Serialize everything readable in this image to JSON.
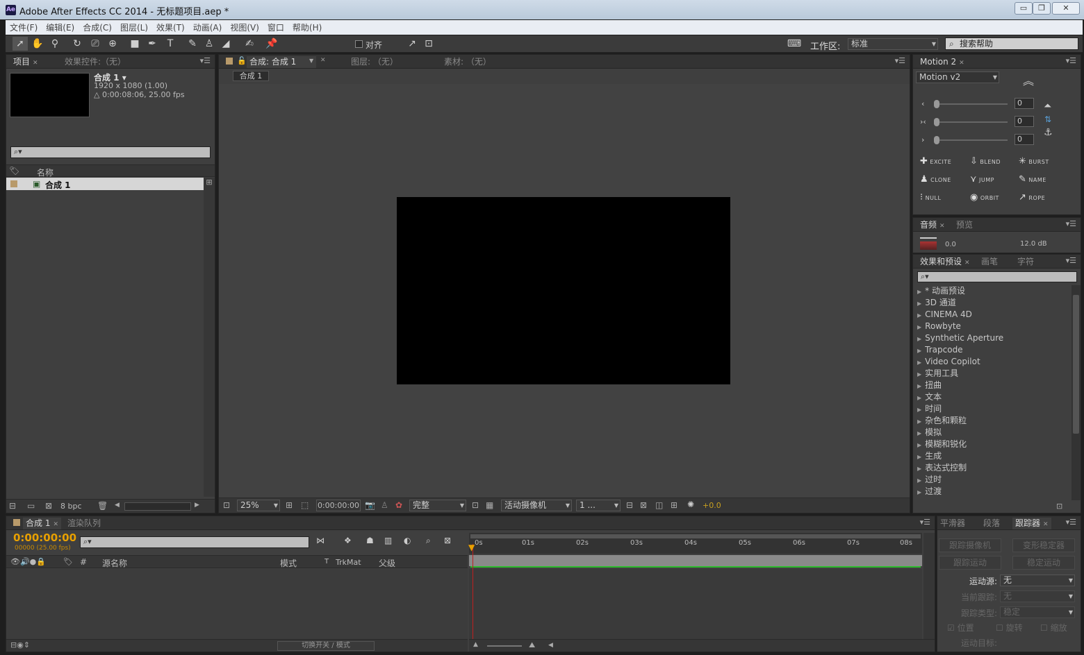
{
  "app": {
    "title": "Adobe After Effects CC 2014 - 无标题项目.aep *",
    "logo": "Ae"
  },
  "window_controls": {
    "minimize": "▭",
    "restore": "❐",
    "close": "✕"
  },
  "menu": [
    "文件(F)",
    "编辑(E)",
    "合成(C)",
    "图层(L)",
    "效果(T)",
    "动画(A)",
    "视图(V)",
    "窗口",
    "帮助(H)"
  ],
  "toolbar": {
    "snap_label": "对齐",
    "workspace_label": "工作区:",
    "workspace_value": "标准",
    "search_help_placeholder": "搜索帮助"
  },
  "project_panel": {
    "tab_project": "项目",
    "tab_effects_controls": "效果控件:（无）",
    "comp_name": "合成 1 ▾",
    "comp_res": "1920 x 1080 (1.00)",
    "comp_duration": "△ 0:00:08:06, 25.00 fps",
    "search_icon": "⌕▾",
    "col_name": "名称",
    "item_name": "合成 1",
    "bpc": "8 bpc"
  },
  "composition_panel": {
    "tab_comp": "合成: 合成 1",
    "tab_layer": "图层: （无）",
    "tab_footage": "素材: （无）",
    "subtab": "合成 1",
    "zoom": "25%",
    "timecode": "0:00:00:00",
    "resolution": "完整",
    "camera": "活动摄像机",
    "views": "1 ...",
    "exposure": "+0.0"
  },
  "motion_panel": {
    "tab": "Motion 2",
    "preset": "Motion v2",
    "slider_values": [
      "0",
      "0",
      "0"
    ],
    "buttons": [
      "EXCITE",
      "BLEND",
      "BURST",
      "CLONE",
      "JUMP",
      "NAME",
      "NULL",
      "ORBIT",
      "ROPE"
    ],
    "button_icons": [
      "✚",
      "⇩",
      "✳",
      "♟",
      "⋎",
      "✎",
      "⁝",
      "◉",
      "↗"
    ]
  },
  "audio_panel": {
    "tab_audio": "音频",
    "tab_preview": "预览",
    "level_left": "0.0",
    "level_right": "12.0 dB"
  },
  "effects_panel": {
    "tab_effects": "效果和预设",
    "tab_brush": "画笔",
    "tab_char": "字符",
    "items": [
      "* 动画预设",
      "3D 通道",
      "CINEMA 4D",
      "Rowbyte",
      "Synthetic Aperture",
      "Trapcode",
      "Video Copilot",
      "实用工具",
      "扭曲",
      "文本",
      "时间",
      "杂色和颗粒",
      "模拟",
      "模糊和锐化",
      "生成",
      "表达式控制",
      "过时",
      "过渡"
    ]
  },
  "timeline_panel": {
    "tab_comp": "合成 1",
    "tab_render": "渲染队列",
    "timecode": "0:00:00:00",
    "frame_info": "00000 (25.00 fps)",
    "col_source": "源名称",
    "col_mode": "模式",
    "col_t": "T",
    "col_trkmat": "TrkMat",
    "col_parent": "父级",
    "toggle_label": "切换开关 / 模式",
    "ruler": [
      "0s",
      "01s",
      "02s",
      "03s",
      "04s",
      "05s",
      "06s",
      "07s",
      "08s"
    ]
  },
  "tracker_panel": {
    "tab_smoother": "平滑器",
    "tab_paragraph": "段落",
    "tab_tracker": "跟踪器",
    "btn_track_camera": "跟踪摄像机",
    "btn_warp_stab": "变形稳定器",
    "btn_track_motion": "跟踪运动",
    "btn_stabilize": "稳定运动",
    "source_label": "运动源:",
    "source_value": "无",
    "current_track_label": "当前跟踪:",
    "current_track_value": "无",
    "track_type_label": "跟踪类型:",
    "track_type_value": "稳定",
    "cb_position": "位置",
    "cb_rotation": "旋转",
    "cb_scale": "缩放",
    "target_label": "运动目标:"
  },
  "colors": {
    "accent_timecode": "#e8a000",
    "playhead": "#e8a000",
    "work_area": "#2cbb2c"
  }
}
